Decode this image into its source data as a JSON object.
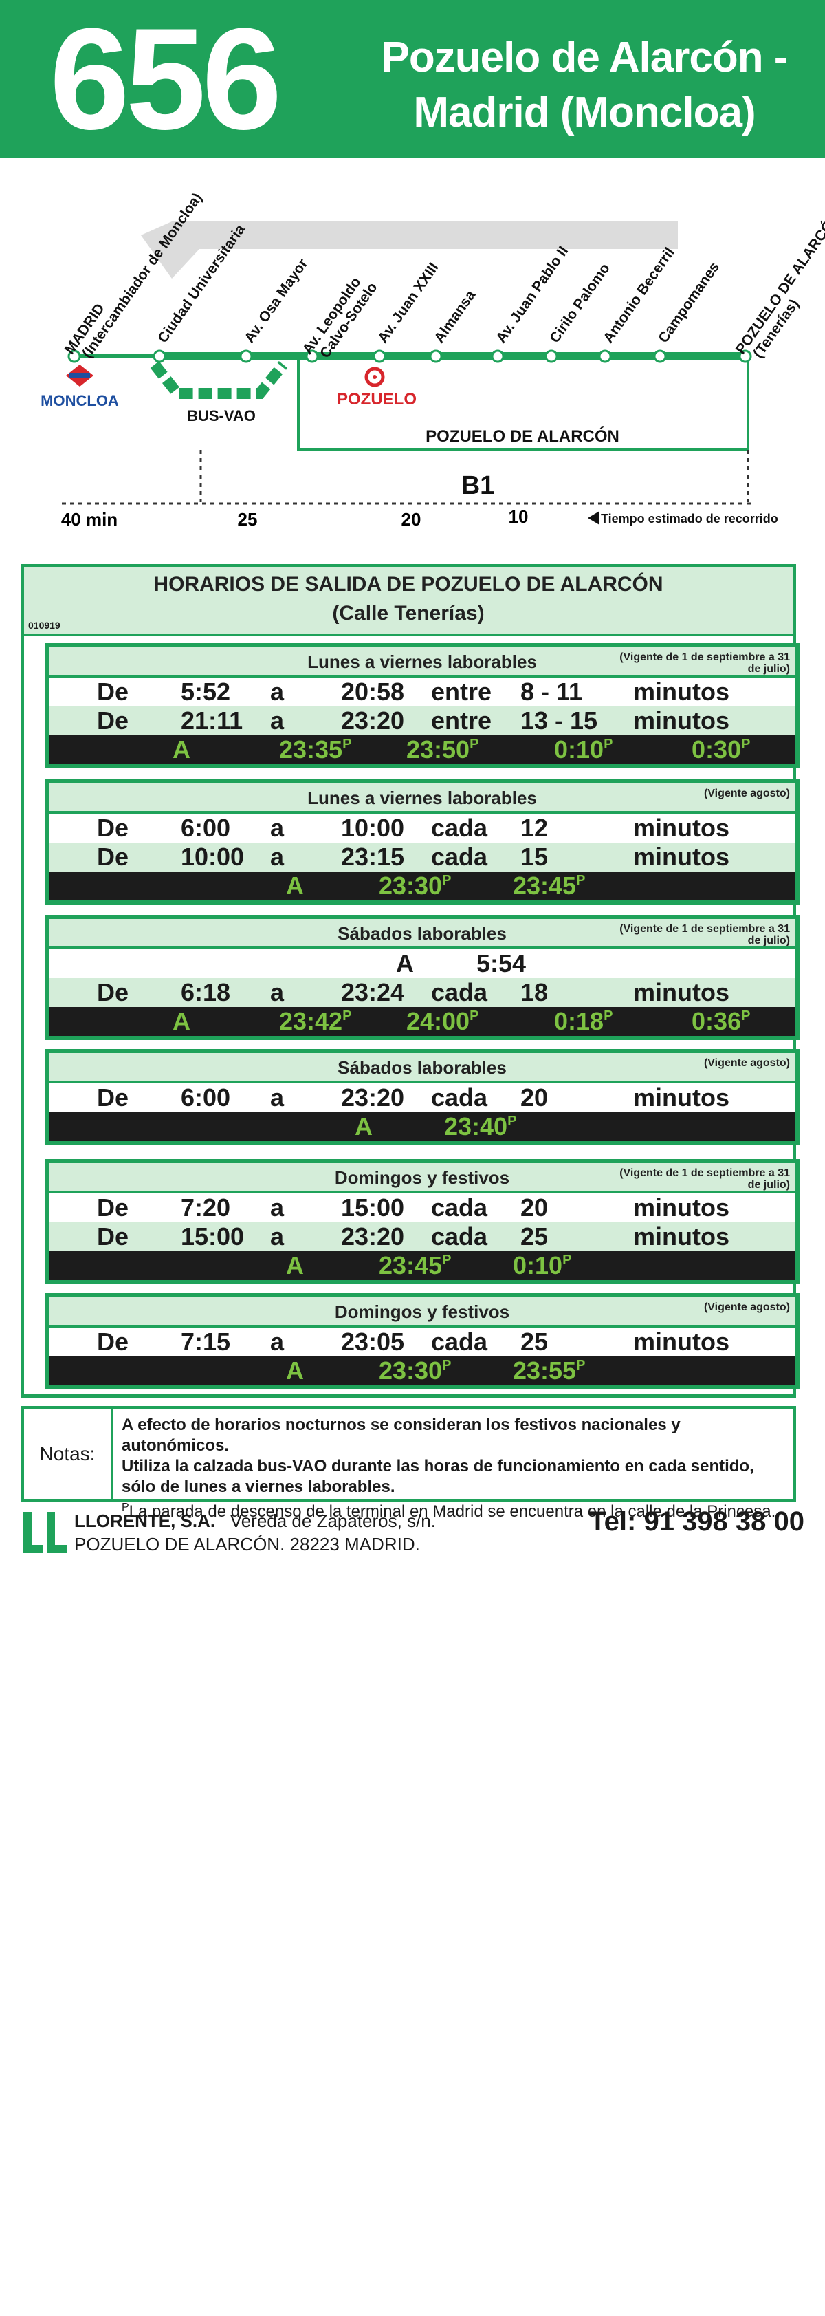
{
  "header": {
    "route_number": "656",
    "title_line1": "Pozuelo de Alarcón -",
    "title_line2": "Madrid (Moncloa)"
  },
  "map": {
    "stops": [
      {
        "label": "MADRID",
        "label2": "(Intercambiador de Moncloa)"
      },
      {
        "label": "Ciudad Universitaria"
      },
      {
        "label": "Av. Osa Mayor"
      },
      {
        "label": "Av. Leopoldo",
        "label2": "Calvo-Sotelo"
      },
      {
        "label": "Av. Juan XXIII"
      },
      {
        "label": "Almansa"
      },
      {
        "label": "Av. Juan Pablo II"
      },
      {
        "label": "Cirilo Palomo"
      },
      {
        "label": "Antonio Becerril"
      },
      {
        "label": "Campomanes"
      },
      {
        "label": "POZUELO DE ALARCÓN",
        "label2": "(Tenerías)"
      }
    ],
    "moncloa_label": "MONCLOA",
    "pozuelo_label": "POZUELO",
    "busvao_label": "BUS-VAO",
    "zone_label": "POZUELO DE ALARCÓN",
    "fare_zone": "B1",
    "times": [
      "40 min",
      "25",
      "20",
      "10"
    ],
    "time_legend": "Tiempo estimado de recorrido"
  },
  "schedule": {
    "title": "HORARIOS DE SALIDA DE POZUELO DE ALARCÓN",
    "subtitle": "(Calle Tenerías)",
    "code": "010919",
    "blocks": [
      {
        "title": "Lunes a viernes laborables",
        "validity": "(Vigente de 1 de septiembre a 31 de julio)",
        "rows": [
          [
            "De",
            "5:52",
            "a",
            "20:58",
            "entre",
            "8 - 11",
            "minutos"
          ],
          [
            "De",
            "21:11",
            "a",
            "23:20",
            "entre",
            "13 - 15",
            "minutos"
          ]
        ],
        "night": [
          "A",
          "23:35",
          "23:50",
          "0:10",
          "0:30"
        ]
      },
      {
        "title": "Lunes a viernes laborables",
        "validity": "(Vigente agosto)",
        "rows": [
          [
            "De",
            "6:00",
            "a",
            "10:00",
            "cada",
            "12",
            "minutos"
          ],
          [
            "De",
            "10:00",
            "a",
            "23:15",
            "cada",
            "15",
            "minutos"
          ]
        ],
        "night": [
          "A",
          "23:30",
          "23:45"
        ]
      },
      {
        "title": "Sábados laborables",
        "validity": "(Vigente de 1 de septiembre a 31 de julio)",
        "single": [
          "A",
          "5:54"
        ],
        "rows": [
          [
            "De",
            "6:18",
            "a",
            "23:24",
            "cada",
            "18",
            "minutos"
          ]
        ],
        "night": [
          "A",
          "23:42",
          "24:00",
          "0:18",
          "0:36"
        ]
      },
      {
        "title": "Sábados laborables",
        "validity": "(Vigente agosto)",
        "rows": [
          [
            "De",
            "6:00",
            "a",
            "23:20",
            "cada",
            "20",
            "minutos"
          ]
        ],
        "night": [
          "A",
          "23:40"
        ]
      },
      {
        "title": "Domingos y festivos",
        "validity": "(Vigente de 1 de septiembre a 31 de julio)",
        "rows": [
          [
            "De",
            "7:20",
            "a",
            "15:00",
            "cada",
            "20",
            "minutos"
          ],
          [
            "De",
            "15:00",
            "a",
            "23:20",
            "cada",
            "25",
            "minutos"
          ]
        ],
        "night": [
          "A",
          "23:45",
          "0:10"
        ]
      },
      {
        "title": "Domingos y festivos",
        "validity": "(Vigente agosto)",
        "rows": [
          [
            "De",
            "7:15",
            "a",
            "23:05",
            "cada",
            "25",
            "minutos"
          ]
        ],
        "night": [
          "A",
          "23:30",
          "23:55"
        ]
      }
    ],
    "superscript": "P"
  },
  "notes": {
    "label": "Notas:",
    "line1": "A efecto de horarios nocturnos se consideran los festivos nacionales y autonómicos.",
    "line2": "Utiliza la calzada bus-VAO durante las horas de funcionamiento en cada sentido,",
    "line3": "sólo de lunes a viernes laborables.",
    "p_mark": "P",
    "line4": "La parada de descenso de la terminal en Madrid se encuentra en la calle de la Princesa."
  },
  "footer": {
    "company": "LLORENTE, S.A.",
    "street": "Vereda de Zapateros, s/n.",
    "city": "POZUELO DE ALARCÓN. 28223 MADRID.",
    "phone": "Tel: 91 398 38 00"
  },
  "colors": {
    "brand_green": "#1fa25a",
    "light_green": "#d4edd9",
    "night_bg": "#1c1c1c",
    "night_text": "#7dc242",
    "metro_blue": "#1e4fa0",
    "pozuelo_red": "#d7262c"
  }
}
